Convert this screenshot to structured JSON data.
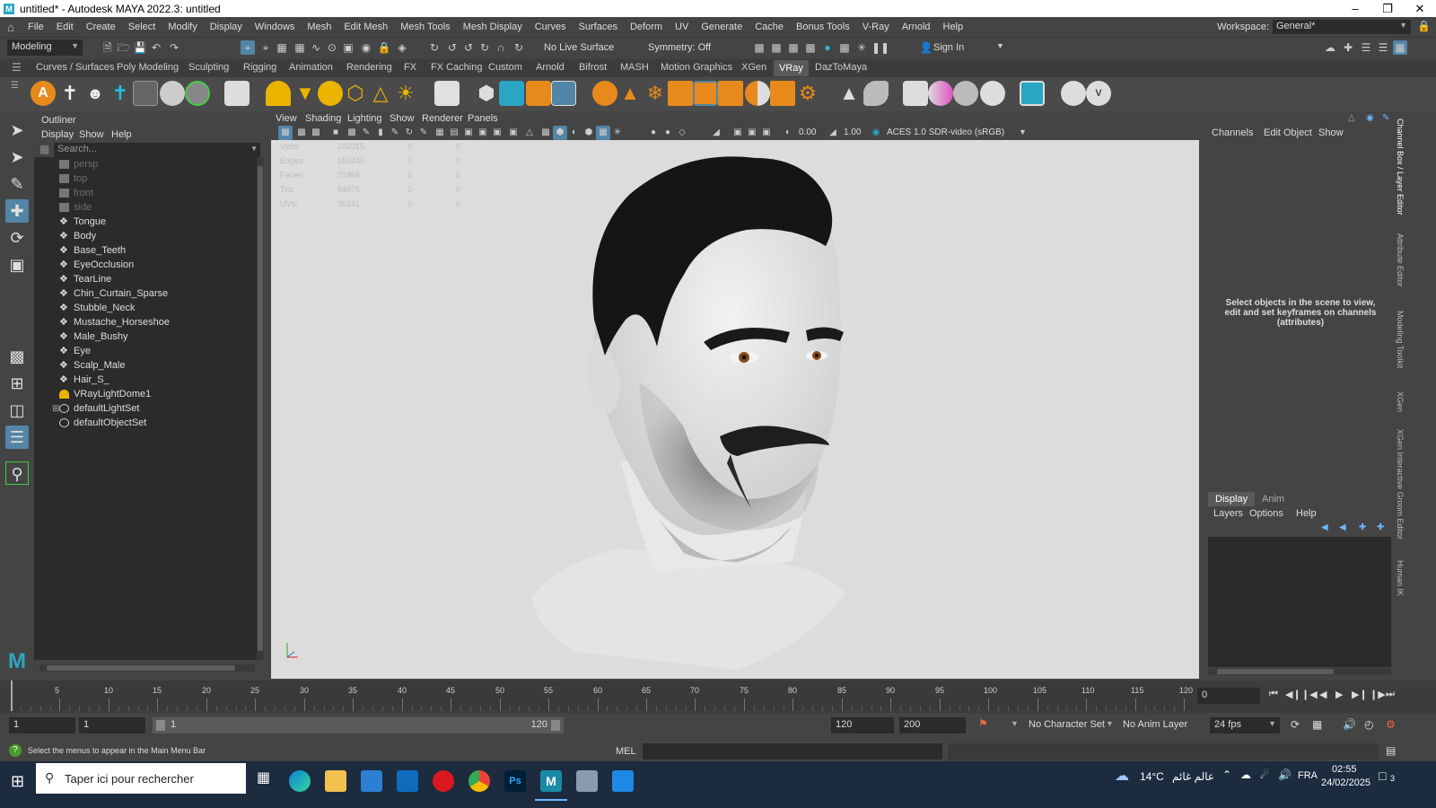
{
  "window": {
    "title": "untitled* - Autodesk MAYA 2022.3: untitled",
    "icon_letter": "M"
  },
  "menubar": {
    "items": [
      "File",
      "Edit",
      "Create",
      "Select",
      "Modify",
      "Display",
      "Windows",
      "Mesh",
      "Edit Mesh",
      "Mesh Tools",
      "Mesh Display",
      "Curves",
      "Surfaces",
      "Deform",
      "UV",
      "Generate",
      "Cache",
      "Bonus Tools",
      "V-Ray",
      "Arnold",
      "Help"
    ],
    "workspace_label": "Workspace:",
    "workspace_value": "General*"
  },
  "statusline": {
    "menuset": "Modeling",
    "live_surface": "No Live Surface",
    "symmetry": "Symmetry: Off",
    "sign_in": "Sign In"
  },
  "shelf": {
    "tabs": [
      "Curves / Surfaces",
      "Poly Modeling",
      "Sculpting",
      "Rigging",
      "Animation",
      "Rendering",
      "FX",
      "FX Caching",
      "Custom",
      "Arnold",
      "Bifrost",
      "MASH",
      "Motion Graphics",
      "XGen",
      "VRay",
      "DazToMaya"
    ],
    "active_tab": "VRay"
  },
  "outliner": {
    "title": "Outliner",
    "menu": [
      "Display",
      "Show",
      "Help"
    ],
    "search_placeholder": "Search...",
    "items": [
      {
        "label": "persp",
        "icon": "camera-icon",
        "dim": true
      },
      {
        "label": "top",
        "icon": "camera-icon",
        "dim": true
      },
      {
        "label": "front",
        "icon": "camera-icon",
        "dim": true
      },
      {
        "label": "side",
        "icon": "camera-icon",
        "dim": true
      },
      {
        "label": "Tongue",
        "icon": "mesh-icon",
        "dim": false
      },
      {
        "label": "Body",
        "icon": "mesh-icon",
        "dim": false
      },
      {
        "label": "Base_Teeth",
        "icon": "mesh-icon",
        "dim": false
      },
      {
        "label": "EyeOcclusion",
        "icon": "mesh-icon",
        "dim": false
      },
      {
        "label": "TearLine",
        "icon": "mesh-icon",
        "dim": false
      },
      {
        "label": "Chin_Curtain_Sparse",
        "icon": "mesh-icon",
        "dim": false
      },
      {
        "label": "Stubble_Neck",
        "icon": "mesh-icon",
        "dim": false
      },
      {
        "label": "Mustache_Horseshoe",
        "icon": "mesh-icon",
        "dim": false
      },
      {
        "label": "Male_Bushy",
        "icon": "mesh-icon",
        "dim": false
      },
      {
        "label": "Eye",
        "icon": "mesh-icon",
        "dim": false
      },
      {
        "label": "Scalp_Male",
        "icon": "mesh-icon",
        "dim": false
      },
      {
        "label": "Hair_S_",
        "icon": "mesh-icon",
        "dim": false
      },
      {
        "label": "VRayLightDome1",
        "icon": "dome-light-icon",
        "dim": false
      },
      {
        "label": "defaultLightSet",
        "icon": "set-icon",
        "dim": false,
        "expandable": true
      },
      {
        "label": "defaultObjectSet",
        "icon": "set-icon",
        "dim": false
      }
    ]
  },
  "viewport": {
    "menu": [
      "View",
      "Shading",
      "Lighting",
      "Show",
      "Renderer",
      "Panels"
    ],
    "exposure": "0.00",
    "gamma": "1.00",
    "color_space": "ACES 1.0 SDR-video (sRGB)",
    "hud": [
      {
        "label": "Verts:",
        "value": "102015",
        "a": "0",
        "b": "0"
      },
      {
        "label": "Edges:",
        "value": "156245",
        "a": "0",
        "b": "0"
      },
      {
        "label": "Faces:",
        "value": "71866",
        "a": "0",
        "b": "0"
      },
      {
        "label": "Tris:",
        "value": "84675",
        "a": "0",
        "b": "0"
      },
      {
        "label": "UVs:",
        "value": "36241",
        "a": "0",
        "b": "0"
      }
    ]
  },
  "channelbox": {
    "menu": [
      "Channels",
      "Edit",
      "Object",
      "Show"
    ],
    "message": "Select objects in the scene to view, edit and set keyframes on channels (attributes)"
  },
  "layereditor": {
    "tabs": [
      "Display",
      "Anim"
    ],
    "menu": [
      "Layers",
      "Options",
      "Help"
    ]
  },
  "sidetabs": [
    "Channel Box / Layer Editor",
    "Attribute Editor",
    "Modeling Toolkit",
    "XGen",
    "XGen Interactive Groom Editor",
    "Human IK"
  ],
  "timeline": {
    "ticks": [
      "5",
      "10",
      "15",
      "20",
      "25",
      "30",
      "35",
      "40",
      "45",
      "50",
      "55",
      "60",
      "65",
      "70",
      "75",
      "80",
      "85",
      "90",
      "95",
      "100",
      "105",
      "110",
      "115",
      "120"
    ],
    "current_frame": "0"
  },
  "range": {
    "start": "1",
    "playback_start": "1",
    "slider_start": "1",
    "slider_end": "120",
    "playback_end": "120",
    "end": "200",
    "character_set": "No Character Set",
    "anim_layer": "No Anim Layer",
    "fps": "24 fps"
  },
  "helpline": {
    "message": "Select the menus to appear in the Main Menu Bar",
    "mel_label": "MEL"
  },
  "taskbar": {
    "search_placeholder": "Taper ici pour rechercher",
    "weather": "14°C",
    "weather_text": "عالم غائم",
    "language": "FRA",
    "time": "02:55",
    "date": "24/02/2025",
    "notification_count": "3"
  },
  "colors": {
    "accent_blue": "#5285a6",
    "active_tab": "#5a5a5a",
    "viewport_bg": "#dcdcdc"
  }
}
